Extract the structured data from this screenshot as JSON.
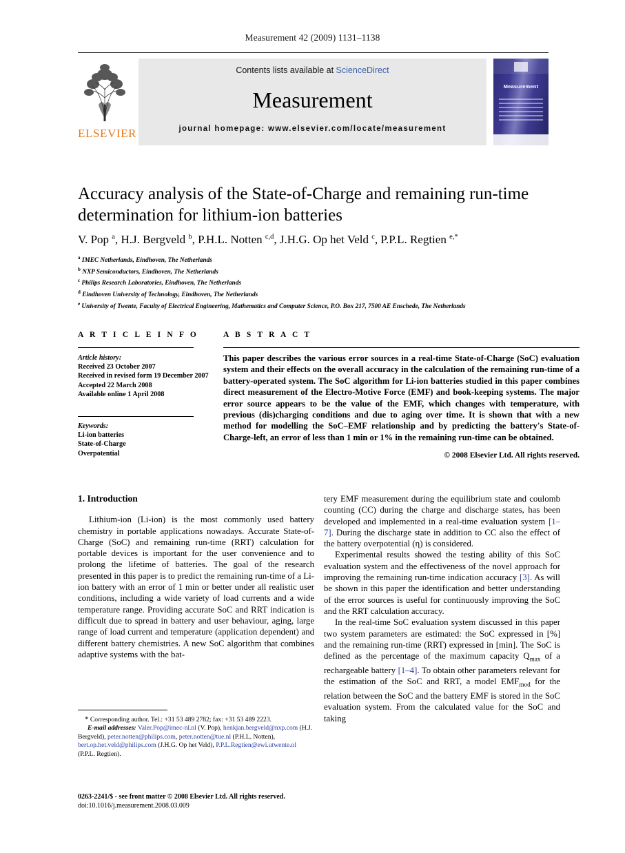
{
  "running_head": "Measurement 42 (2009) 1131–1138",
  "masthead": {
    "contents_prefix": "Contents lists available at ",
    "sciencedirect": "ScienceDirect",
    "journal_title": "Measurement",
    "homepage": "journal homepage: www.elsevier.com/locate/measurement",
    "publisher_name": "ELSEVIER",
    "cover_title": "Measurement",
    "link_color": "#3a5fa8",
    "brand_color": "#e77817",
    "band_color": "#e8e8e8"
  },
  "article": {
    "title": "Accuracy analysis of the State-of-Charge and remaining run-time determination for lithium-ion batteries",
    "authors_html": "V. Pop <sup>a</sup>, H.J. Bergveld <sup>b</sup>, P.H.L. Notten <sup>c,d</sup>, J.H.G. Op het Veld <sup>c</sup>, P.P.L. Regtien <sup>e,*</sup>",
    "affiliations": [
      {
        "mark": "a",
        "text": "IMEC Netherlands, Eindhoven, The Netherlands"
      },
      {
        "mark": "b",
        "text": "NXP Semiconductors, Eindhoven, The Netherlands"
      },
      {
        "mark": "c",
        "text": "Philips Research Laboratories, Eindhoven, The Netherlands"
      },
      {
        "mark": "d",
        "text": "Eindhoven University of Technology, Eindhoven, The Netherlands"
      },
      {
        "mark": "e",
        "text": "University of Twente, Faculty of Electrical Engineering, Mathematics and Computer Science, P.O. Box 217, 7500 AE Enschede, The Netherlands"
      }
    ]
  },
  "info": {
    "heading": "A R T I C L E    I N F O",
    "history_label": "Article history:",
    "history": [
      "Received 23 October 2007",
      "Received in revised form 19 December 2007",
      "Accepted 22 March 2008",
      "Available online 1 April 2008"
    ],
    "keywords_label": "Keywords:",
    "keywords": [
      "Li-ion batteries",
      "State-of-Charge",
      "Overpotential"
    ]
  },
  "abstract": {
    "heading": "A B S T R A C T",
    "text": "This paper describes the various error sources in a real-time State-of-Charge (SoC) evaluation system and their effects on the overall accuracy in the calculation of the remaining run-time of a battery-operated system. The SoC algorithm for Li-ion batteries studied in this paper combines direct measurement of the Electro-Motive Force (EMF) and book-keeping systems. The major error source appears to be the value of the EMF, which changes with temperature, with previous (dis)charging conditions and due to aging over time. It is shown that with a new method for modelling the SoC–EMF relationship and by predicting the battery's State-of-Charge-left, an error of less than 1 min or 1% in the remaining run-time can be obtained.",
    "copyright": "© 2008 Elsevier Ltd. All rights reserved."
  },
  "body": {
    "section_number_title": "1. Introduction",
    "left_p1": "Lithium-ion (Li-ion) is the most commonly used battery chemistry in portable applications nowadays. Accurate State-of-Charge (SoC) and remaining run-time (RRT) calculation for portable devices is important for the user convenience and to prolong the lifetime of batteries. The goal of the research presented in this paper is to predict the remaining run-time of a Li-ion battery with an error of 1 min or better under all realistic user conditions, including a wide variety of load currents and a wide temperature range. Providing accurate SoC and RRT indication is difficult due to spread in battery and user behaviour, aging, large range of load current and temperature (application dependent) and different battery chemistries. A new SoC algorithm that combines adaptive systems with the bat-",
    "right_p1_a": "tery EMF measurement during the equilibrium state and coulomb counting (CC) during the charge and discharge states, has been developed and implemented in a real-time evaluation system ",
    "right_p1_ref": "[1–7]",
    "right_p1_b": ". During the discharge state in addition to CC also the effect of the battery overpotential (η) is considered.",
    "right_p2_a": "Experimental results showed the testing ability of this SoC evaluation system and the effectiveness of the novel approach for improving the remaining run-time indication accuracy ",
    "right_p2_ref": "[3]",
    "right_p2_b": ". As will be shown in this paper the identification and better understanding of the error sources is useful for continuously improving the SoC and the RRT calculation accuracy.",
    "right_p3_a": "In the real-time SoC evaluation system discussed in this paper two system parameters are estimated: the SoC expressed in [%] and the remaining run-time (RRT) expressed in [min]. The SoC is defined as the percentage of the maximum capacity Q",
    "right_p3_sub1": "max",
    "right_p3_b": " of a rechargeable battery ",
    "right_p3_ref": "[1–4]",
    "right_p3_c": ". To obtain other parameters relevant for the estimation of the SoC and RRT, a model EMF",
    "right_p3_sub2": "mod",
    "right_p3_d": " for the relation between the SoC and the battery EMF is stored in the SoC evaluation system. From the calculated value for the SoC and taking"
  },
  "footnote": {
    "star": "*",
    "corresponding": " Corresponding author. Tel.: +31 53 489 2782; fax: +31 53 489 2223.",
    "email_label": "E-mail addresses:",
    "emails_html": " <span class=\"mail\">Valer.Pop@imec-nl.nl</span> (V. Pop), <span class=\"mail\">henkjan.bergveld@nxp.com</span> (H.J. Bergveld), <span class=\"mail\">peter.notten@philips.com</span>, <span class=\"mail\">peter.notten@tue.nl</span> (P.H.L. Notten), <span class=\"mail\">bert.op.het.veld@philips.com</span> (J.H.G. Op het Veld), <span class=\"mail\">P.P.L.Regtien@ewi.utwente.nl</span> (P.P.L. Regtien).",
    "issn_line": "0263-2241/$ - see front matter © 2008 Elsevier Ltd. All rights reserved.",
    "doi_line": "doi:10.1016/j.measurement.2008.03.009"
  }
}
